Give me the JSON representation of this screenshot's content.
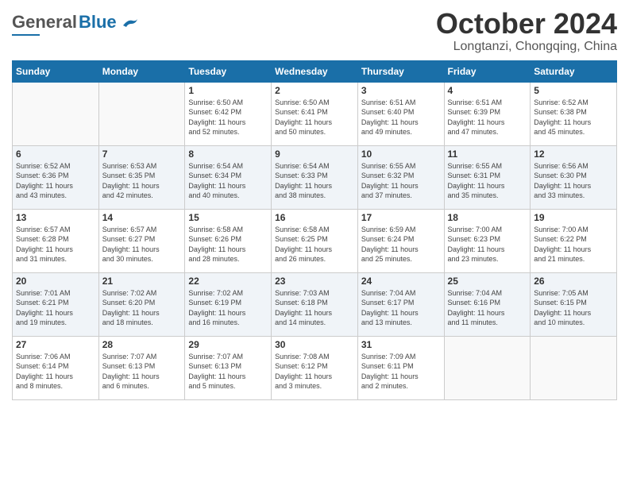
{
  "header": {
    "logo_general": "General",
    "logo_blue": "Blue",
    "month_title": "October 2024",
    "location": "Longtanzi, Chongqing, China"
  },
  "days_of_week": [
    "Sunday",
    "Monday",
    "Tuesday",
    "Wednesday",
    "Thursday",
    "Friday",
    "Saturday"
  ],
  "weeks": [
    [
      {
        "num": "",
        "info": ""
      },
      {
        "num": "",
        "info": ""
      },
      {
        "num": "1",
        "info": "Sunrise: 6:50 AM\nSunset: 6:42 PM\nDaylight: 11 hours\nand 52 minutes."
      },
      {
        "num": "2",
        "info": "Sunrise: 6:50 AM\nSunset: 6:41 PM\nDaylight: 11 hours\nand 50 minutes."
      },
      {
        "num": "3",
        "info": "Sunrise: 6:51 AM\nSunset: 6:40 PM\nDaylight: 11 hours\nand 49 minutes."
      },
      {
        "num": "4",
        "info": "Sunrise: 6:51 AM\nSunset: 6:39 PM\nDaylight: 11 hours\nand 47 minutes."
      },
      {
        "num": "5",
        "info": "Sunrise: 6:52 AM\nSunset: 6:38 PM\nDaylight: 11 hours\nand 45 minutes."
      }
    ],
    [
      {
        "num": "6",
        "info": "Sunrise: 6:52 AM\nSunset: 6:36 PM\nDaylight: 11 hours\nand 43 minutes."
      },
      {
        "num": "7",
        "info": "Sunrise: 6:53 AM\nSunset: 6:35 PM\nDaylight: 11 hours\nand 42 minutes."
      },
      {
        "num": "8",
        "info": "Sunrise: 6:54 AM\nSunset: 6:34 PM\nDaylight: 11 hours\nand 40 minutes."
      },
      {
        "num": "9",
        "info": "Sunrise: 6:54 AM\nSunset: 6:33 PM\nDaylight: 11 hours\nand 38 minutes."
      },
      {
        "num": "10",
        "info": "Sunrise: 6:55 AM\nSunset: 6:32 PM\nDaylight: 11 hours\nand 37 minutes."
      },
      {
        "num": "11",
        "info": "Sunrise: 6:55 AM\nSunset: 6:31 PM\nDaylight: 11 hours\nand 35 minutes."
      },
      {
        "num": "12",
        "info": "Sunrise: 6:56 AM\nSunset: 6:30 PM\nDaylight: 11 hours\nand 33 minutes."
      }
    ],
    [
      {
        "num": "13",
        "info": "Sunrise: 6:57 AM\nSunset: 6:28 PM\nDaylight: 11 hours\nand 31 minutes."
      },
      {
        "num": "14",
        "info": "Sunrise: 6:57 AM\nSunset: 6:27 PM\nDaylight: 11 hours\nand 30 minutes."
      },
      {
        "num": "15",
        "info": "Sunrise: 6:58 AM\nSunset: 6:26 PM\nDaylight: 11 hours\nand 28 minutes."
      },
      {
        "num": "16",
        "info": "Sunrise: 6:58 AM\nSunset: 6:25 PM\nDaylight: 11 hours\nand 26 minutes."
      },
      {
        "num": "17",
        "info": "Sunrise: 6:59 AM\nSunset: 6:24 PM\nDaylight: 11 hours\nand 25 minutes."
      },
      {
        "num": "18",
        "info": "Sunrise: 7:00 AM\nSunset: 6:23 PM\nDaylight: 11 hours\nand 23 minutes."
      },
      {
        "num": "19",
        "info": "Sunrise: 7:00 AM\nSunset: 6:22 PM\nDaylight: 11 hours\nand 21 minutes."
      }
    ],
    [
      {
        "num": "20",
        "info": "Sunrise: 7:01 AM\nSunset: 6:21 PM\nDaylight: 11 hours\nand 19 minutes."
      },
      {
        "num": "21",
        "info": "Sunrise: 7:02 AM\nSunset: 6:20 PM\nDaylight: 11 hours\nand 18 minutes."
      },
      {
        "num": "22",
        "info": "Sunrise: 7:02 AM\nSunset: 6:19 PM\nDaylight: 11 hours\nand 16 minutes."
      },
      {
        "num": "23",
        "info": "Sunrise: 7:03 AM\nSunset: 6:18 PM\nDaylight: 11 hours\nand 14 minutes."
      },
      {
        "num": "24",
        "info": "Sunrise: 7:04 AM\nSunset: 6:17 PM\nDaylight: 11 hours\nand 13 minutes."
      },
      {
        "num": "25",
        "info": "Sunrise: 7:04 AM\nSunset: 6:16 PM\nDaylight: 11 hours\nand 11 minutes."
      },
      {
        "num": "26",
        "info": "Sunrise: 7:05 AM\nSunset: 6:15 PM\nDaylight: 11 hours\nand 10 minutes."
      }
    ],
    [
      {
        "num": "27",
        "info": "Sunrise: 7:06 AM\nSunset: 6:14 PM\nDaylight: 11 hours\nand 8 minutes."
      },
      {
        "num": "28",
        "info": "Sunrise: 7:07 AM\nSunset: 6:13 PM\nDaylight: 11 hours\nand 6 minutes."
      },
      {
        "num": "29",
        "info": "Sunrise: 7:07 AM\nSunset: 6:13 PM\nDaylight: 11 hours\nand 5 minutes."
      },
      {
        "num": "30",
        "info": "Sunrise: 7:08 AM\nSunset: 6:12 PM\nDaylight: 11 hours\nand 3 minutes."
      },
      {
        "num": "31",
        "info": "Sunrise: 7:09 AM\nSunset: 6:11 PM\nDaylight: 11 hours\nand 2 minutes."
      },
      {
        "num": "",
        "info": ""
      },
      {
        "num": "",
        "info": ""
      }
    ]
  ]
}
